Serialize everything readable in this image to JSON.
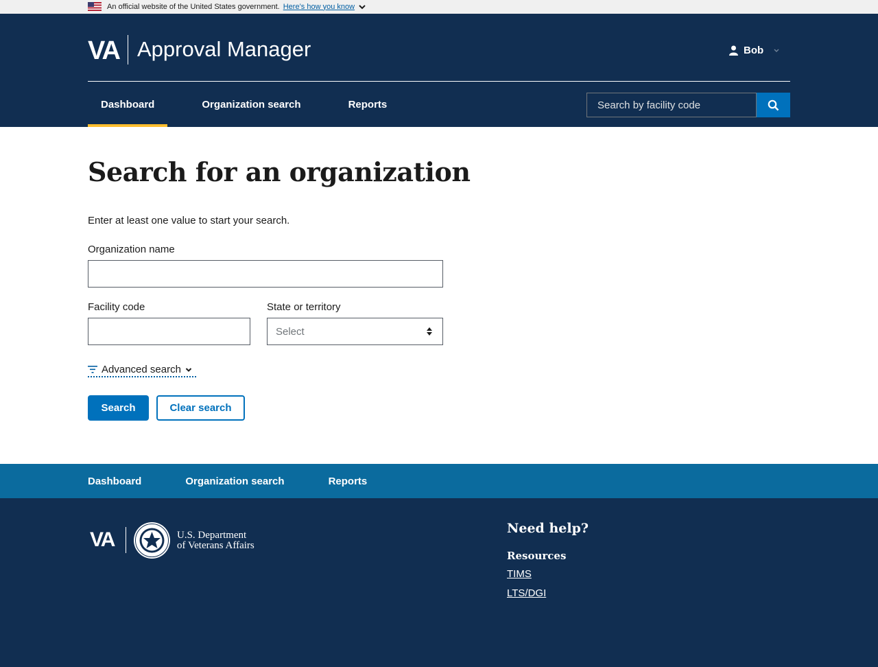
{
  "banner": {
    "text": "An official website of the United States government.",
    "link": "Here’s how you know"
  },
  "header": {
    "logo": "VA",
    "title": "Approval Manager",
    "user": "Bob",
    "nav": [
      {
        "label": "Dashboard",
        "active": true
      },
      {
        "label": "Organization search",
        "active": false
      },
      {
        "label": "Reports",
        "active": false
      }
    ],
    "search_placeholder": "Search by facility code"
  },
  "main": {
    "heading": "Search for an organization",
    "intro": "Enter at least one value to start your search.",
    "org_name_label": "Organization name",
    "org_name_value": "",
    "facility_label": "Facility code",
    "facility_value": "",
    "state_label": "State or territory",
    "state_value": "Select",
    "advanced": "Advanced search",
    "search_button": "Search",
    "clear_button": "Clear search"
  },
  "footer_nav": [
    "Dashboard",
    "Organization search",
    "Reports"
  ],
  "footer": {
    "logo": "VA",
    "dept_line1": "U.S. Department",
    "dept_line2": "of Veterans Affairs",
    "need_help": "Need help?",
    "resources": "Resources",
    "links": [
      "TIMS",
      "LTS/DGI"
    ]
  },
  "colors": {
    "navy": "#112e51",
    "accent_blue": "#0071bc",
    "footer_nav": "#0b6b9e",
    "active_underline": "#ffbe2e"
  },
  "icons": [
    "us-flag-icon",
    "chevron-down-icon",
    "user-icon",
    "search-icon",
    "filter-icon",
    "sort-arrows-icon",
    "va-seal-icon"
  ]
}
